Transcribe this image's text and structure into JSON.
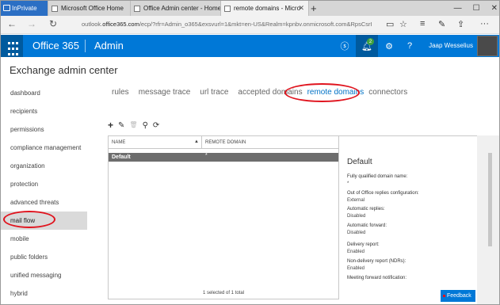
{
  "browser": {
    "tabs": [
      {
        "label": "InPrivate"
      },
      {
        "label": "Microsoft Office Home"
      },
      {
        "label": "Office Admin center - Home"
      },
      {
        "label": "remote domains - Micro"
      }
    ],
    "new_tab": "+",
    "url_prefix": "outlook.",
    "url_domain": "office365.com",
    "url_rest": "/ecp/?rfr=Admin_o365&exsvurl=1&mkt=en-US&Realm=kpnbv.onmicrosoft.com&RpsCsrI"
  },
  "header": {
    "brand": "Office 365",
    "section": "Admin",
    "notification_count": "2",
    "user": "Jaap Wesselius",
    "colors": {
      "bar": "#0078d7",
      "waffle": "#005a9e"
    }
  },
  "page_title": "Exchange admin center",
  "sidebar": {
    "items": [
      {
        "label": "dashboard"
      },
      {
        "label": "recipients"
      },
      {
        "label": "permissions"
      },
      {
        "label": "compliance management"
      },
      {
        "label": "organization"
      },
      {
        "label": "protection"
      },
      {
        "label": "advanced threats"
      },
      {
        "label": "mail flow"
      },
      {
        "label": "mobile"
      },
      {
        "label": "public folders"
      },
      {
        "label": "unified messaging"
      },
      {
        "label": "hybrid"
      }
    ],
    "selected": "mail flow"
  },
  "subtabs": [
    {
      "label": "rules"
    },
    {
      "label": "message trace"
    },
    {
      "label": "url trace"
    },
    {
      "label": "accepted domains"
    },
    {
      "label": "remote domains"
    },
    {
      "label": "connectors"
    }
  ],
  "toolbar": {
    "add": "+",
    "edit": "✎",
    "delete": "🗑",
    "search": "⚲",
    "refresh": "⟳"
  },
  "grid": {
    "columns": [
      "NAME",
      "REMOTE DOMAIN"
    ],
    "rows": [
      {
        "name": "Default",
        "remote_domain": "*"
      }
    ],
    "status": "1 selected of 1 total"
  },
  "details": {
    "title": "Default",
    "fields": [
      {
        "label": "Fully qualified domain name:",
        "value": "*"
      },
      {
        "label": "Out of Office replies configuration:",
        "value": "External"
      },
      {
        "label": "Automatic replies:",
        "value": "Disabled"
      },
      {
        "label": "Automatic forward:",
        "value": "Disabled"
      },
      {
        "label": "Delivery report:",
        "value": "Enabled"
      },
      {
        "label": "Non-delivery report (NDRs):",
        "value": "Enabled"
      },
      {
        "label": "Meeting forward notification:",
        "value": ""
      }
    ]
  },
  "feedback": "Feedback",
  "annotation_color": "#e0141e"
}
